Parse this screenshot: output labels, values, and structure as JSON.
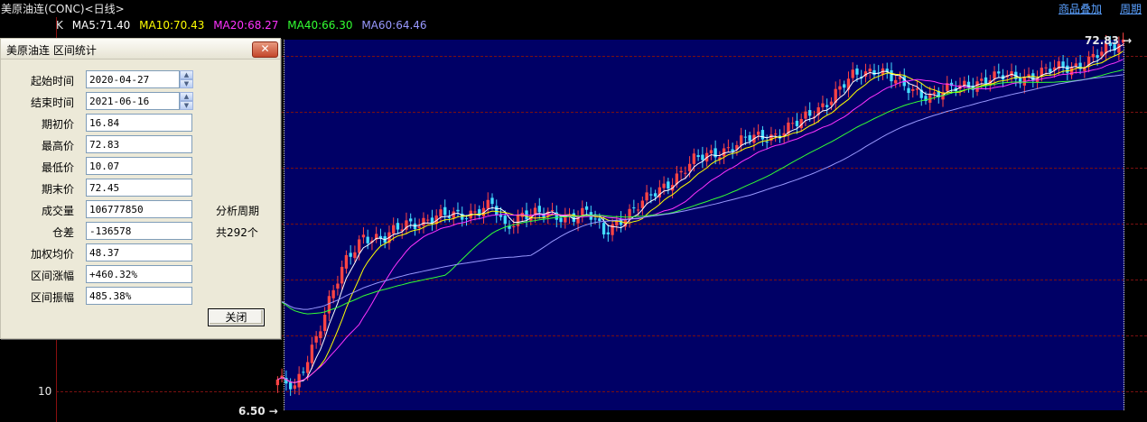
{
  "header": {
    "title": "美原油连(CONC)<日线>",
    "link_overlay": "商品叠加",
    "link_period": "周期"
  },
  "ma_bar": {
    "k_label": "K",
    "items": [
      {
        "label": "MA5:71.40",
        "color": "#ffffff"
      },
      {
        "label": "MA10:70.43",
        "color": "#ffff00"
      },
      {
        "label": "MA20:68.27",
        "color": "#ff33ff"
      },
      {
        "label": "MA40:66.30",
        "color": "#33ff33"
      },
      {
        "label": "MA60:64.46",
        "color": "#9999ff"
      }
    ]
  },
  "chart": {
    "y_tick": "10",
    "high_label": "72.83",
    "low_label": "6.50",
    "bg_color": "#000066",
    "up_color": "#ff4444",
    "down_color": "#44ddff"
  },
  "chart_data": {
    "type": "line",
    "x_start": "2020-04-27",
    "x_end": "2021-06-16",
    "high": 72.83,
    "low": 6.5,
    "y_tick_labels": [
      "10"
    ],
    "series": [
      {
        "name": "MA5",
        "values": [
          71.4
        ]
      },
      {
        "name": "MA10",
        "values": [
          70.43
        ]
      },
      {
        "name": "MA20",
        "values": [
          68.27
        ]
      },
      {
        "name": "MA40",
        "values": [
          66.3
        ]
      },
      {
        "name": "MA60",
        "values": [
          64.46
        ]
      }
    ],
    "price_path": [
      [
        0,
        12
      ],
      [
        4,
        10
      ],
      [
        8,
        18
      ],
      [
        12,
        26
      ],
      [
        16,
        33
      ],
      [
        20,
        38
      ],
      [
        25,
        37
      ],
      [
        30,
        40
      ],
      [
        38,
        41
      ],
      [
        45,
        42
      ],
      [
        50,
        43
      ],
      [
        53,
        39
      ],
      [
        57,
        42
      ],
      [
        65,
        41
      ],
      [
        72,
        42
      ],
      [
        76,
        38
      ],
      [
        80,
        41
      ],
      [
        86,
        44
      ],
      [
        92,
        48
      ],
      [
        97,
        51
      ],
      [
        103,
        53
      ],
      [
        110,
        55
      ],
      [
        116,
        56
      ],
      [
        122,
        58
      ],
      [
        128,
        62
      ],
      [
        134,
        66
      ],
      [
        140,
        68
      ],
      [
        146,
        64
      ],
      [
        152,
        63
      ],
      [
        158,
        64
      ],
      [
        165,
        66
      ],
      [
        172,
        66
      ],
      [
        178,
        67
      ],
      [
        185,
        68
      ],
      [
        191,
        70
      ],
      [
        197,
        72.4
      ]
    ]
  },
  "dialog": {
    "title": "美原油连 区间统计",
    "close_label": "✕",
    "fields": [
      {
        "label": "起始时间",
        "value": "2020-04-27"
      },
      {
        "label": "结束时间",
        "value": "2021-06-16"
      },
      {
        "label": "期初价",
        "value": "16.84"
      },
      {
        "label": "最高价",
        "value": "72.83"
      },
      {
        "label": "最低价",
        "value": "10.07"
      },
      {
        "label": "期末价",
        "value": "72.45"
      },
      {
        "label": "成交量",
        "value": "106777850"
      },
      {
        "label": "仓差",
        "value": "-136578"
      },
      {
        "label": "加权均价",
        "value": "48.37"
      },
      {
        "label": "区间涨幅",
        "value": "+460.32%"
      },
      {
        "label": "区间振幅",
        "value": "485.38%"
      }
    ],
    "period_label": "分析周期",
    "period_value": "共292个",
    "close_button": "关闭"
  }
}
